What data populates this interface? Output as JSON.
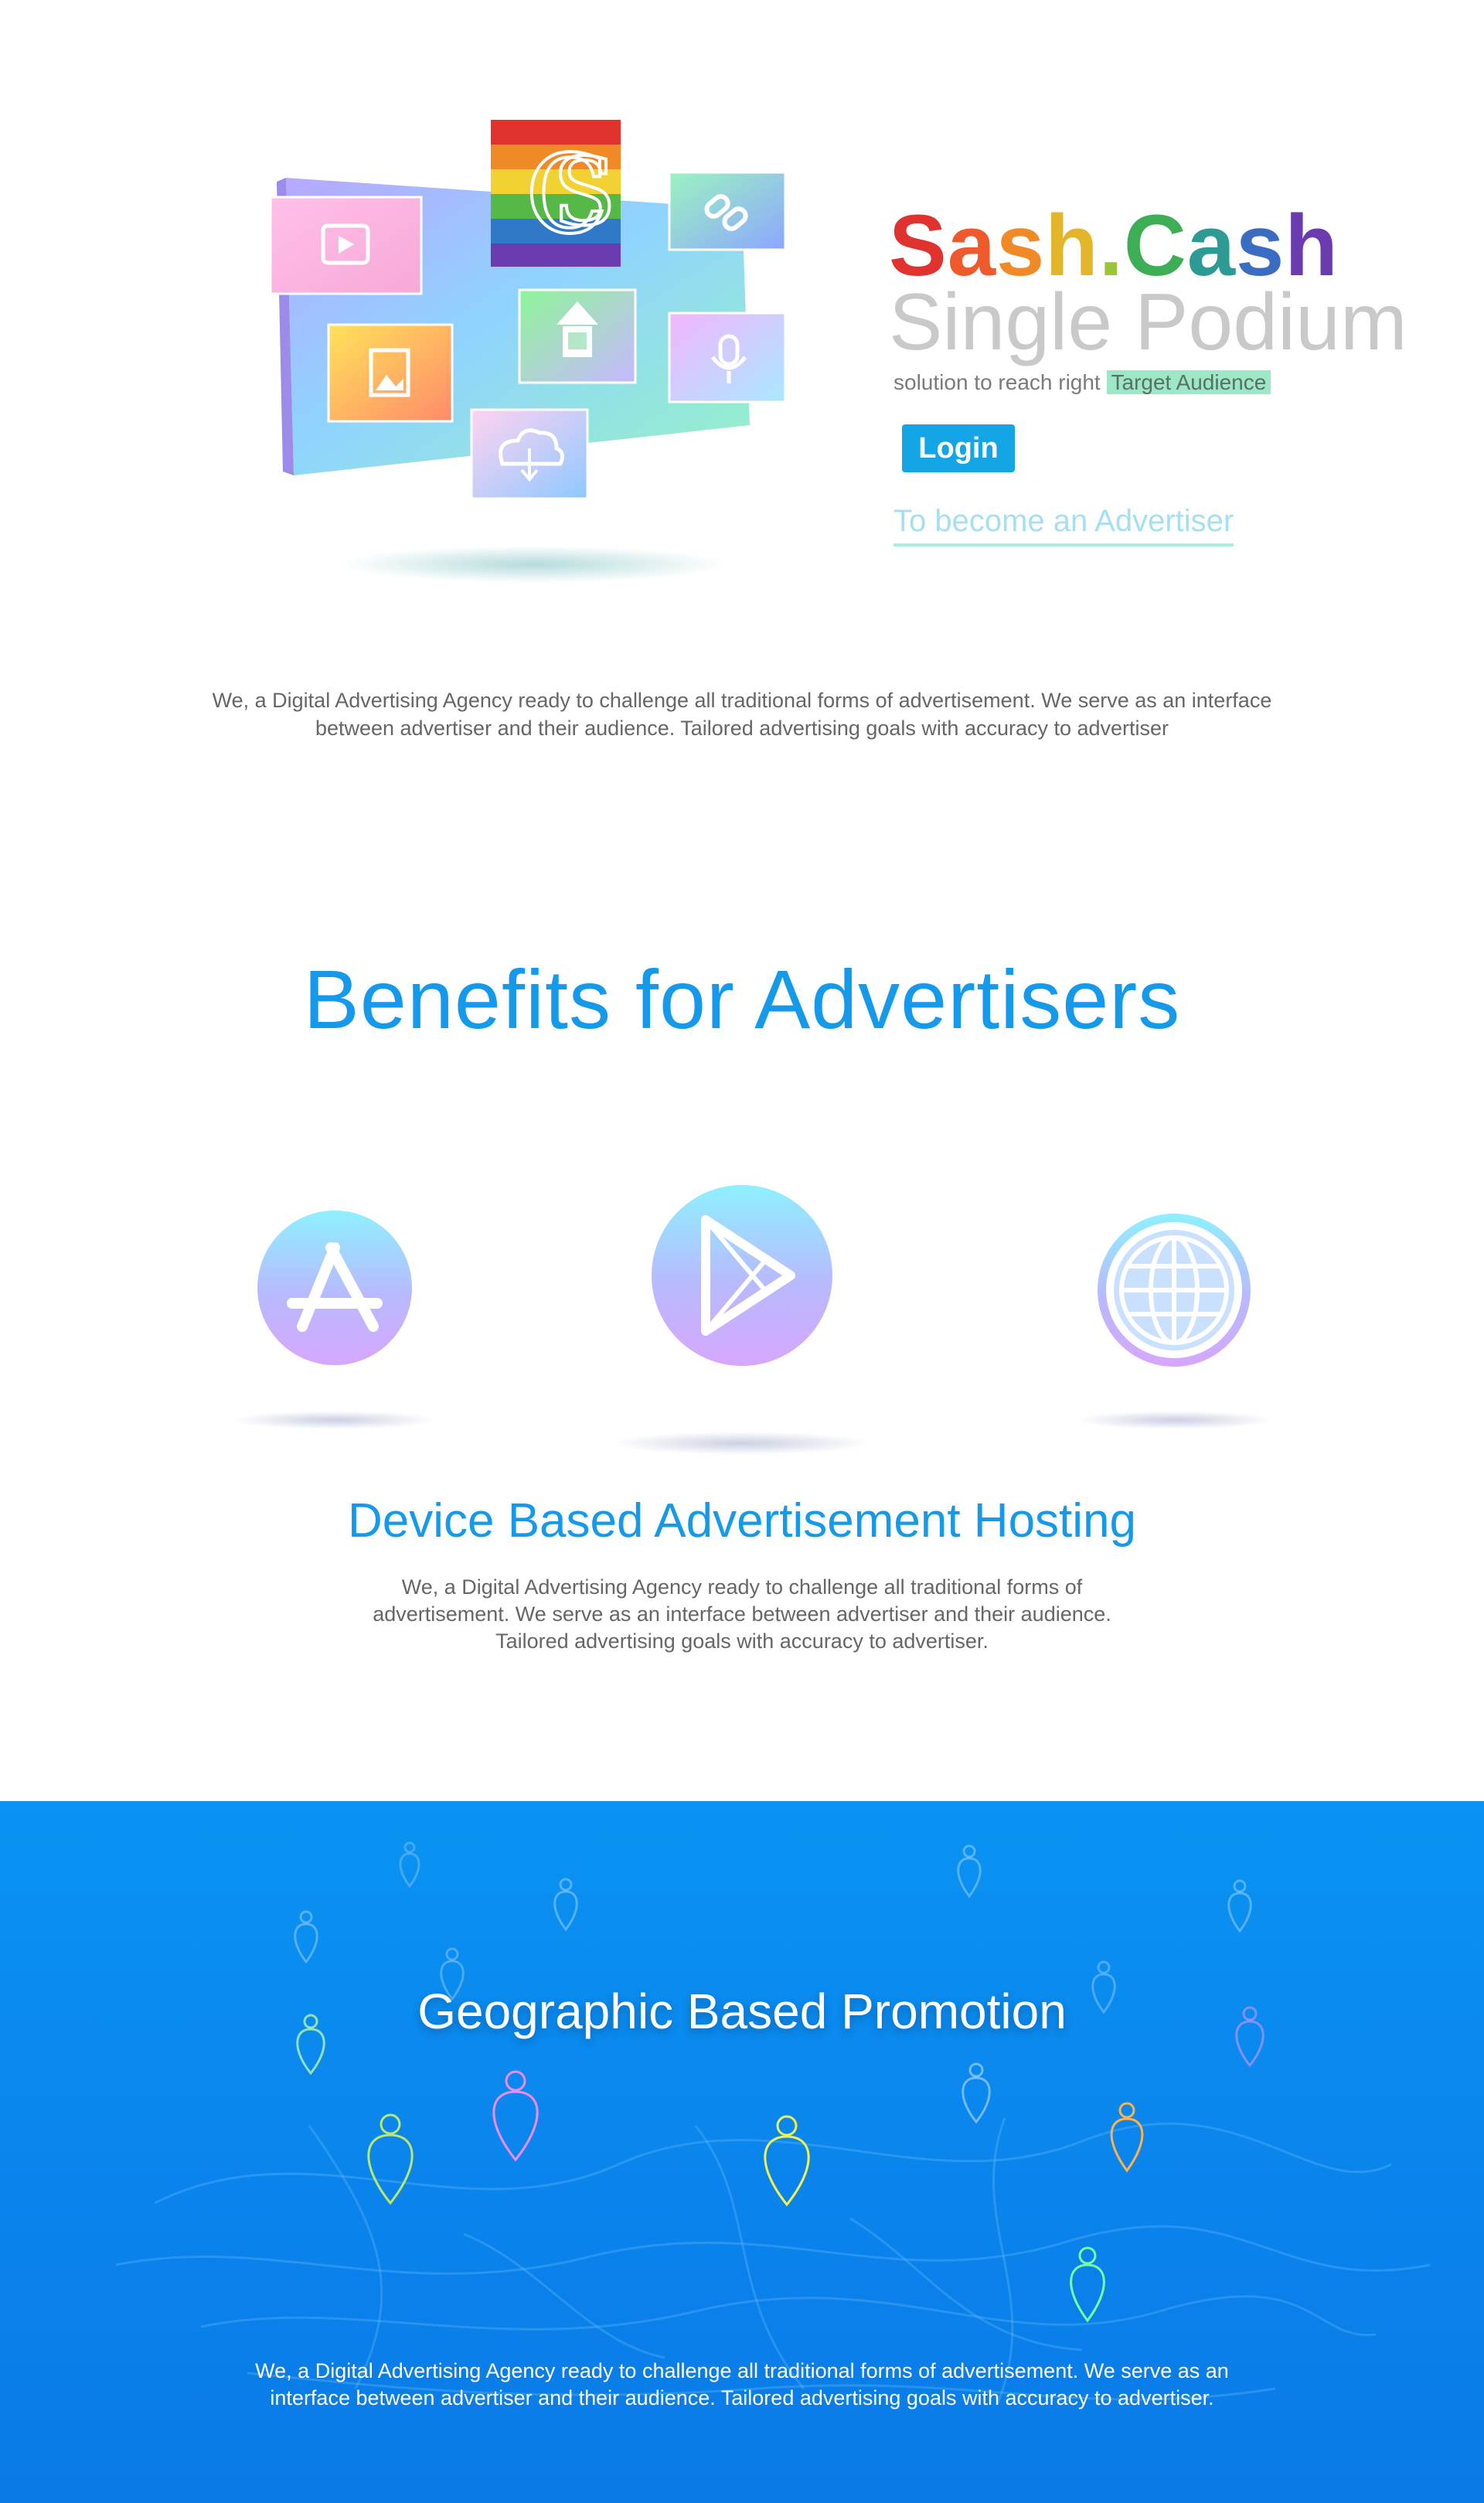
{
  "hero": {
    "brand_letters": [
      {
        "ch": "S",
        "color": "#e0322f"
      },
      {
        "ch": "a",
        "color": "#ef5a2c"
      },
      {
        "ch": "s",
        "color": "#f08a26"
      },
      {
        "ch": "h",
        "color": "#e3b52a"
      },
      {
        "ch": ".",
        "color": "#9cc43b"
      },
      {
        "ch": "C",
        "color": "#3dae56"
      },
      {
        "ch": "a",
        "color": "#2d9b93"
      },
      {
        "ch": "s",
        "color": "#3a6cc2"
      },
      {
        "ch": "h",
        "color": "#6b3bb0"
      }
    ],
    "subtitle": "Single Podium",
    "tagline_prefix": "solution to reach right",
    "tagline_highlight": "Target Audience",
    "login_label": "Login",
    "advertiser_link": "To become an Advertiser",
    "intro": "We, a Digital Advertising Agency ready to challenge all traditional forms of advertisement. We serve as an interface between advertiser and their audience. Tailored advertising goals with accuracy to advertiser",
    "icons": [
      "video-icon",
      "logo-icon",
      "link-icon",
      "image-icon",
      "home-icon",
      "microphone-icon",
      "cloud-download-icon"
    ]
  },
  "benefits": {
    "title": "Benefits for Advertisers",
    "icons": [
      "app-store-icon",
      "play-store-icon",
      "globe-icon"
    ],
    "device_title": "Device Based Advertisement Hosting",
    "device_text": "We, a Digital Advertising Agency ready to challenge all traditional forms of advertisement. We serve as an interface  between advertiser and their audience. Tailored advertising goals with accuracy to advertiser."
  },
  "geo": {
    "title": "Geographic Based Promotion",
    "text": "We, a Digital Advertising Agency ready to challenge all traditional forms of advertisement. We serve as an interface  between advertiser and their audience. Tailored advertising goals with accuracy to advertiser."
  },
  "colors": {
    "accent": "#1599ea",
    "login_bg": "#12a6e6",
    "highlight": "#9ce8c6",
    "geo_bg": "#0a88ee"
  }
}
